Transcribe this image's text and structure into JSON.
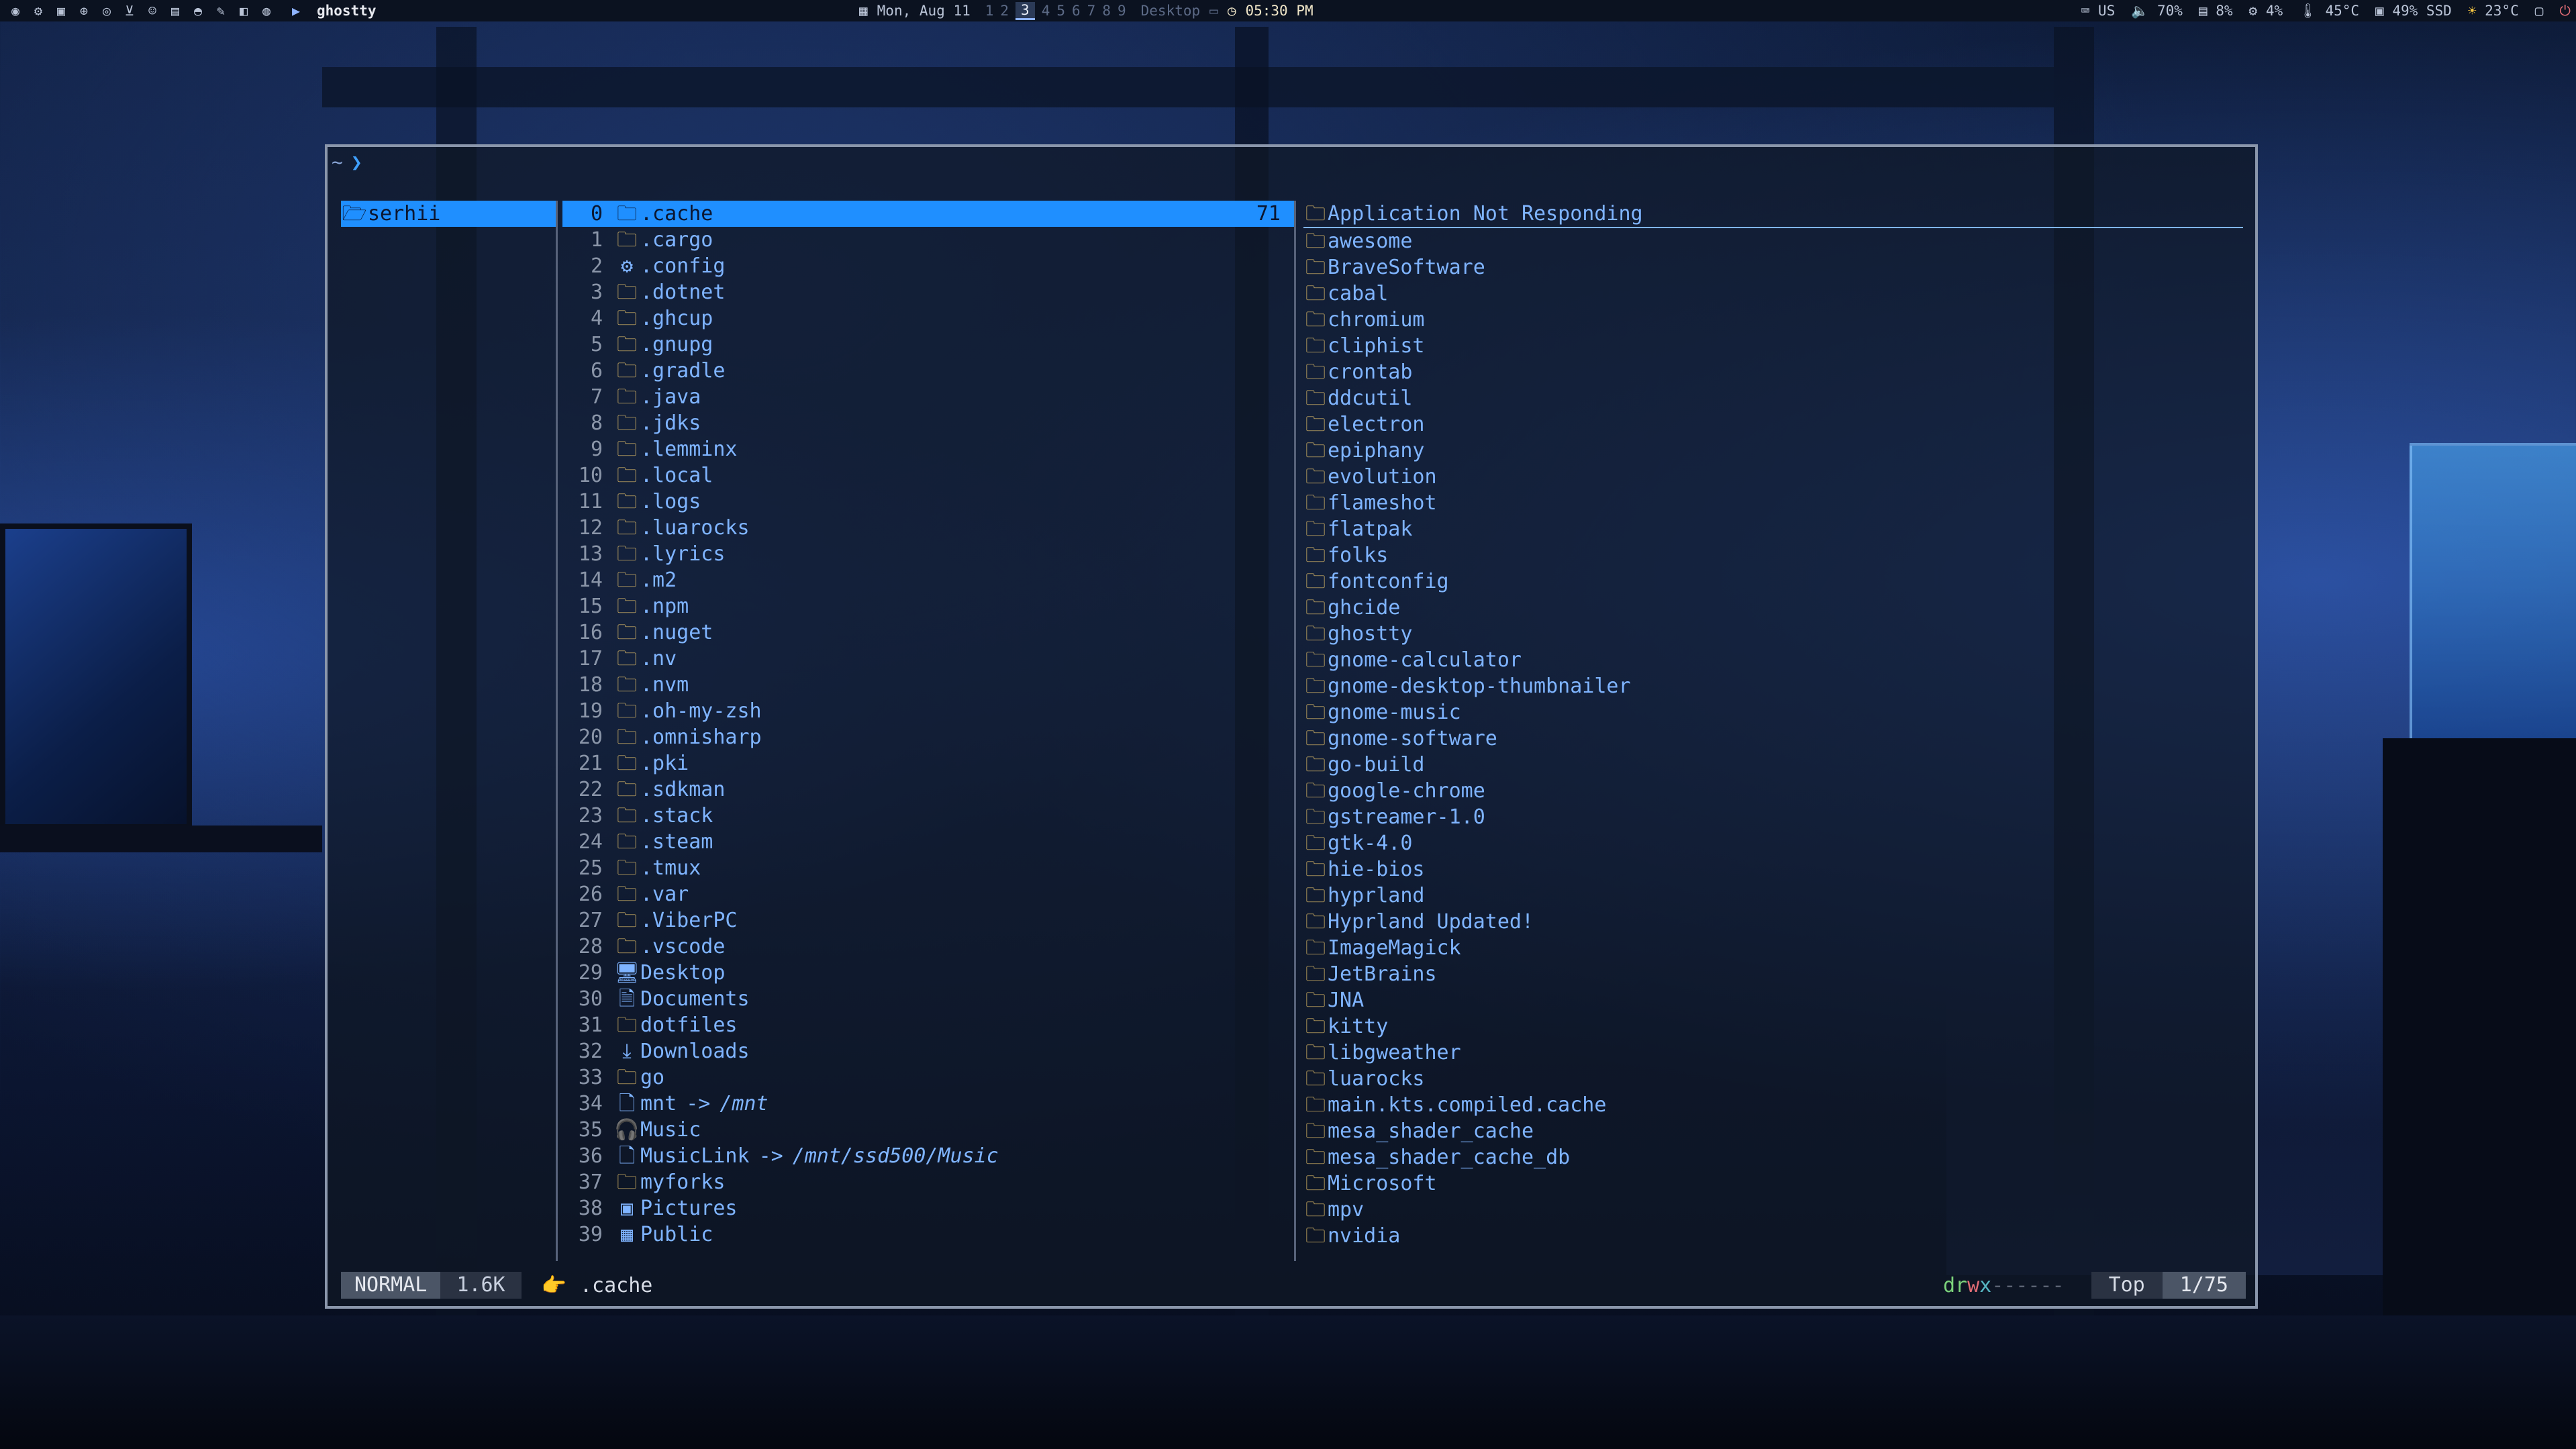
{
  "topbar": {
    "app_title": "ghostty",
    "date": "Mon, Aug 11",
    "workspaces": [
      "1",
      "2",
      "3",
      "4",
      "5",
      "6",
      "7",
      "8",
      "9"
    ],
    "active_workspace": "3",
    "desktop_label": "Desktop",
    "time": "05:30 PM",
    "keyboard_layout": "US",
    "volume": "70%",
    "memory": "8%",
    "cpu": "4%",
    "temperature": "45°C",
    "disk": "49% SSD",
    "weather": "23°C"
  },
  "prompt": {
    "tilde": "~",
    "symbol": "❯"
  },
  "left_pane": {
    "current": "serhii"
  },
  "middle_pane": {
    "count_label": "71",
    "items": [
      {
        "n": "0",
        "name": ".cache",
        "icon": "folder-icon"
      },
      {
        "n": "1",
        "name": ".cargo",
        "icon": "folder-icon"
      },
      {
        "n": "2",
        "name": ".config",
        "icon": "config-folder-icon"
      },
      {
        "n": "3",
        "name": ".dotnet",
        "icon": "folder-icon"
      },
      {
        "n": "4",
        "name": ".ghcup",
        "icon": "folder-icon"
      },
      {
        "n": "5",
        "name": ".gnupg",
        "icon": "folder-icon"
      },
      {
        "n": "6",
        "name": ".gradle",
        "icon": "folder-icon"
      },
      {
        "n": "7",
        "name": ".java",
        "icon": "folder-icon"
      },
      {
        "n": "8",
        "name": ".jdks",
        "icon": "folder-icon"
      },
      {
        "n": "9",
        "name": ".lemminx",
        "icon": "folder-icon"
      },
      {
        "n": "10",
        "name": ".local",
        "icon": "folder-icon"
      },
      {
        "n": "11",
        "name": ".logs",
        "icon": "folder-icon"
      },
      {
        "n": "12",
        "name": ".luarocks",
        "icon": "folder-icon"
      },
      {
        "n": "13",
        "name": ".lyrics",
        "icon": "folder-icon"
      },
      {
        "n": "14",
        "name": ".m2",
        "icon": "folder-icon"
      },
      {
        "n": "15",
        "name": ".npm",
        "icon": "folder-icon"
      },
      {
        "n": "16",
        "name": ".nuget",
        "icon": "folder-icon"
      },
      {
        "n": "17",
        "name": ".nv",
        "icon": "folder-icon"
      },
      {
        "n": "18",
        "name": ".nvm",
        "icon": "folder-icon"
      },
      {
        "n": "19",
        "name": ".oh-my-zsh",
        "icon": "folder-icon"
      },
      {
        "n": "20",
        "name": ".omnisharp",
        "icon": "folder-icon"
      },
      {
        "n": "21",
        "name": ".pki",
        "icon": "folder-icon"
      },
      {
        "n": "22",
        "name": ".sdkman",
        "icon": "folder-icon"
      },
      {
        "n": "23",
        "name": ".stack",
        "icon": "folder-icon"
      },
      {
        "n": "24",
        "name": ".steam",
        "icon": "folder-icon"
      },
      {
        "n": "25",
        "name": ".tmux",
        "icon": "folder-icon"
      },
      {
        "n": "26",
        "name": ".var",
        "icon": "folder-icon"
      },
      {
        "n": "27",
        "name": ".ViberPC",
        "icon": "folder-icon"
      },
      {
        "n": "28",
        "name": ".vscode",
        "icon": "folder-icon"
      },
      {
        "n": "29",
        "name": "Desktop",
        "icon": "desktop-icon"
      },
      {
        "n": "30",
        "name": "Documents",
        "icon": "document-icon"
      },
      {
        "n": "31",
        "name": "dotfiles",
        "icon": "folder-icon"
      },
      {
        "n": "32",
        "name": "Downloads",
        "icon": "download-icon"
      },
      {
        "n": "33",
        "name": "go",
        "icon": "folder-icon"
      },
      {
        "n": "34",
        "name": "mnt",
        "icon": "link-file-icon",
        "target": "/mnt"
      },
      {
        "n": "35",
        "name": "Music",
        "icon": "headphones-icon"
      },
      {
        "n": "36",
        "name": "MusicLink",
        "icon": "link-file-icon",
        "target": "/mnt/ssd500/Music"
      },
      {
        "n": "37",
        "name": "myforks",
        "icon": "folder-icon"
      },
      {
        "n": "38",
        "name": "Pictures",
        "icon": "picture-icon"
      },
      {
        "n": "39",
        "name": "Public",
        "icon": "public-icon"
      }
    ]
  },
  "right_pane": {
    "items": [
      "Application Not Responding",
      "awesome",
      "BraveSoftware",
      "cabal",
      "chromium",
      "cliphist",
      "crontab",
      "ddcutil",
      "electron",
      "epiphany",
      "evolution",
      "flameshot",
      "flatpak",
      "folks",
      "fontconfig",
      "ghcide",
      "ghostty",
      "gnome-calculator",
      "gnome-desktop-thumbnailer",
      "gnome-music",
      "gnome-software",
      "go-build",
      "google-chrome",
      "gstreamer-1.0",
      "gtk-4.0",
      "hie-bios",
      "hyprland",
      "Hyprland Updated!",
      "ImageMagick",
      "JetBrains",
      "JNA",
      "kitty",
      "libgweather",
      "luarocks",
      "main.kts.compiled.cache",
      "mesa_shader_cache",
      "mesa_shader_cache_db",
      "Microsoft",
      "mpv",
      "nvidia"
    ]
  },
  "statusbar": {
    "mode": "NORMAL",
    "size": "1.6K",
    "current": ".cache",
    "perm_d": "d",
    "perm_r": "r",
    "perm_w": "w",
    "perm_x": "x",
    "perm_rest": "------",
    "position": "Top",
    "index": "1/75"
  }
}
